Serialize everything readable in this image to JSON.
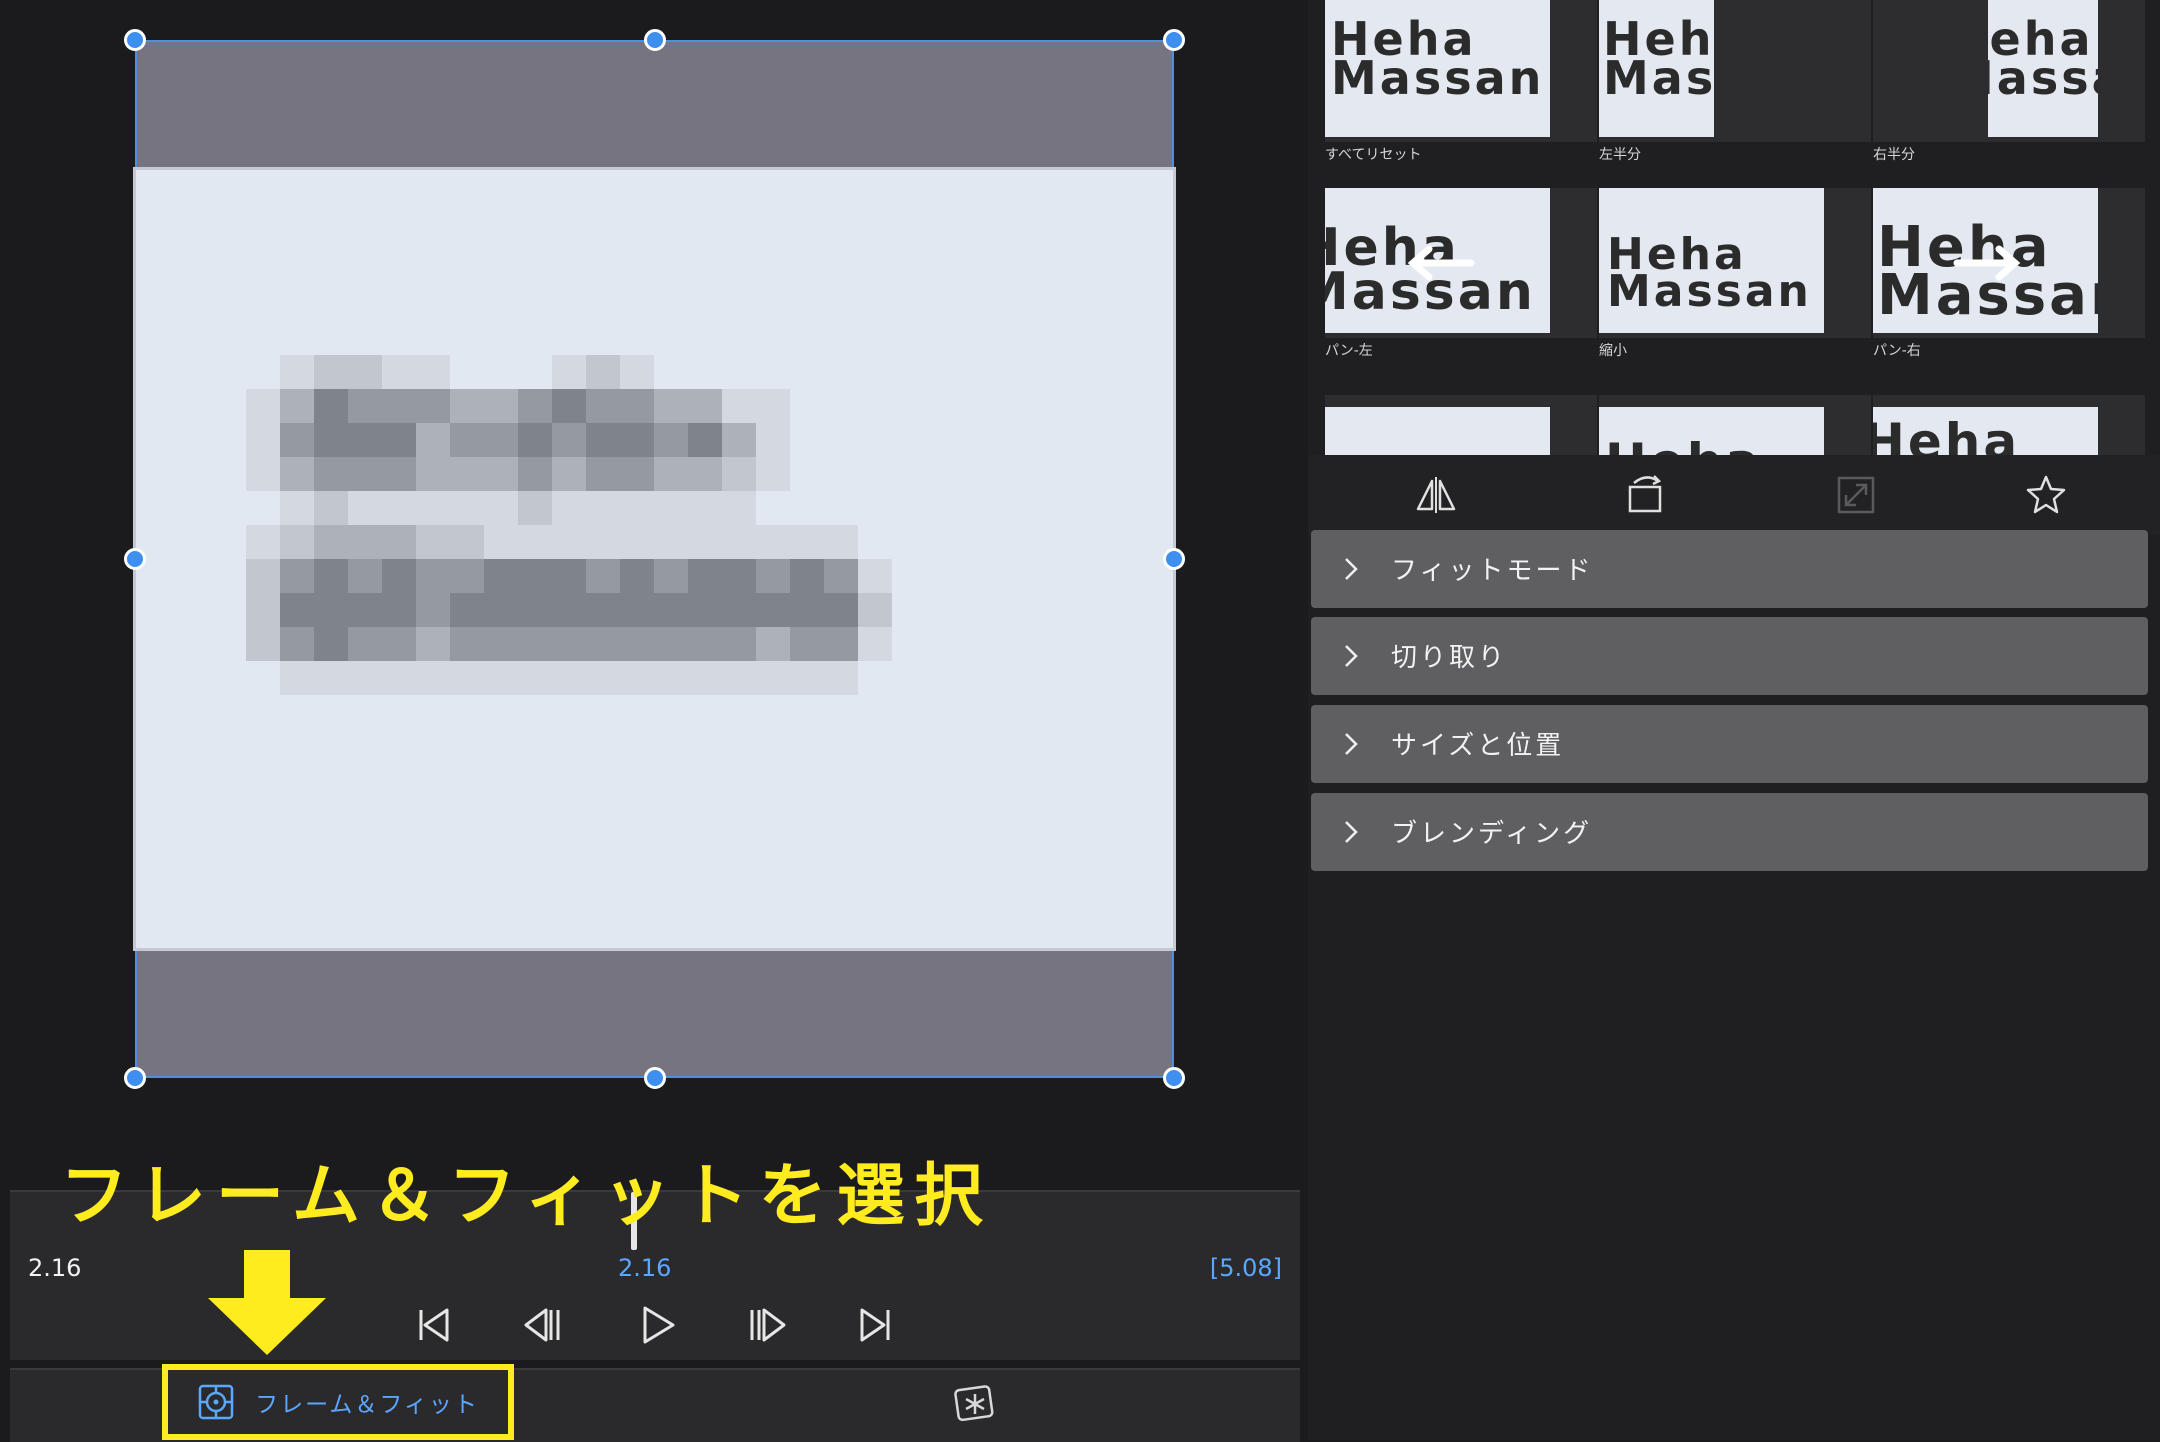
{
  "annotation": {
    "instruction": "フレーム＆フィットを選択"
  },
  "preview": {
    "image_text_line1": "Heha",
    "image_text_line2": "Massan"
  },
  "timeline": {
    "current_time_left": "2.16",
    "playhead_time": "2.16",
    "duration": "[5.08]"
  },
  "transport": {
    "items": [
      {
        "name": "skip-to-start-icon"
      },
      {
        "name": "step-back-icon"
      },
      {
        "name": "play-icon"
      },
      {
        "name": "step-forward-icon"
      },
      {
        "name": "skip-to-end-icon"
      }
    ]
  },
  "bottom_tabs": {
    "frame_fit_label": "フレーム＆フィット",
    "frame_fit_icon": "frame-target-icon",
    "effects_icon": "effects-star-icon"
  },
  "presets": {
    "thumb_text_line1": "Heha",
    "thumb_text_line2": "Massan",
    "items": [
      {
        "label": "すべてリセット"
      },
      {
        "label": "左半分"
      },
      {
        "label": "右半分"
      },
      {
        "label": "パン-左"
      },
      {
        "label": "縮小"
      },
      {
        "label": "パン-右"
      },
      {
        "label": ""
      },
      {
        "label": ""
      },
      {
        "label": ""
      }
    ]
  },
  "toolbar": {
    "icons": [
      "flip-icon",
      "rotate-icon",
      "fit-expand-icon",
      "favorite-star-icon"
    ]
  },
  "accordions": [
    {
      "label": "フィットモード"
    },
    {
      "label": "切り取り"
    },
    {
      "label": "サイズと位置"
    },
    {
      "label": "ブレンディング"
    }
  ],
  "colors": {
    "accent_blue": "#3e8ff0",
    "highlight_yellow": "#ffec1f",
    "frame_gray": "#767480",
    "panel_row": "#5f5f61"
  }
}
